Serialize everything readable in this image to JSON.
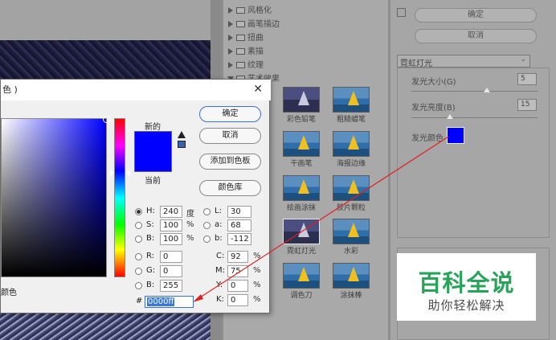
{
  "dialog": {
    "title_fragment": "色 )",
    "new_label": "新的",
    "current_label": "当前",
    "buttons": {
      "ok": "确定",
      "cancel": "取消",
      "add_swatch": "添加到色板",
      "color_library": "颜色库"
    },
    "hsb": {
      "h_label": "H:",
      "h_value": "240",
      "h_unit": "度",
      "s_label": "S:",
      "s_value": "100",
      "s_unit": "%",
      "b_label": "B:",
      "b_value": "100",
      "b_unit": "%"
    },
    "rgb": {
      "r_label": "R:",
      "r_value": "0",
      "g_label": "G:",
      "g_value": "0",
      "b_label": "B:",
      "b_value": "255"
    },
    "lab": {
      "l_label": "L:",
      "l_value": "30",
      "a_label": "a:",
      "a_value": "68",
      "b_label": "b:",
      "b_value": "-112"
    },
    "cmyk": {
      "c_label": "C:",
      "c_value": "92",
      "m_label": "M:",
      "m_value": "75",
      "y_label": "Y:",
      "y_value": "0",
      "k_label": "K:",
      "k_value": "0",
      "unit": "%"
    },
    "hex_label": "#",
    "hex_value": "0000ff",
    "selected_color": "#0000ff",
    "bottom_left_fragment": "颜色"
  },
  "gallery": {
    "categories": [
      "风格化",
      "画笔描边",
      "扭曲",
      "素描",
      "纹理",
      "艺术效果"
    ],
    "thumbs": [
      "彩色铅笔",
      "粗糙蜡笔",
      "干画笔",
      "海报边缘",
      "绘画涂抹",
      "胶片颗粒",
      "霓虹灯光",
      "水彩",
      "调色刀",
      "涂抹棒"
    ]
  },
  "settings": {
    "ok": "确定",
    "cancel": "取消",
    "filter_select": "霓虹灯光",
    "glow_size_label": "发光大小(G)",
    "glow_size_value": "5",
    "glow_brightness_label": "发光亮度(B)",
    "glow_brightness_value": "15",
    "glow_color_label": "发光颜色",
    "glow_color": "#0000ff"
  },
  "watermark": {
    "title": "百科全说",
    "subtitle": "助你轻松解决"
  }
}
